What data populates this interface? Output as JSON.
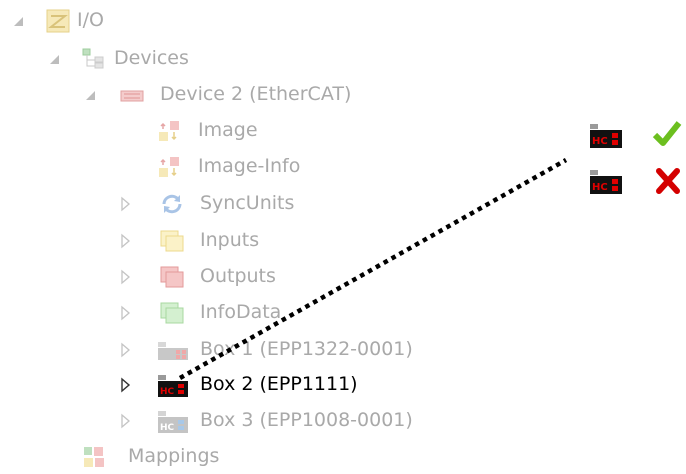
{
  "tree": {
    "io": "I/O",
    "devices": "Devices",
    "device2": "Device 2 (EtherCAT)",
    "image": "Image",
    "image_info": "Image-Info",
    "syncunits": "SyncUnits",
    "inputs": "Inputs",
    "outputs": "Outputs",
    "infodata": "InfoData",
    "box1": "Box 1 (EPP1322-0001)",
    "box2": "Box 2 (EPP1111)",
    "box3": "Box 3 (EPP1008-0001)",
    "mappings": "Mappings"
  },
  "legend": {
    "icon_hc": "HC",
    "ok_icon": "checkmark-icon",
    "error_icon": "cross-icon"
  },
  "colors": {
    "faded_text": "#a9a9a9",
    "active_text": "#000000",
    "check_green": "#6cbf1f",
    "cross_red": "#d40000",
    "hc_red": "#e00000"
  }
}
